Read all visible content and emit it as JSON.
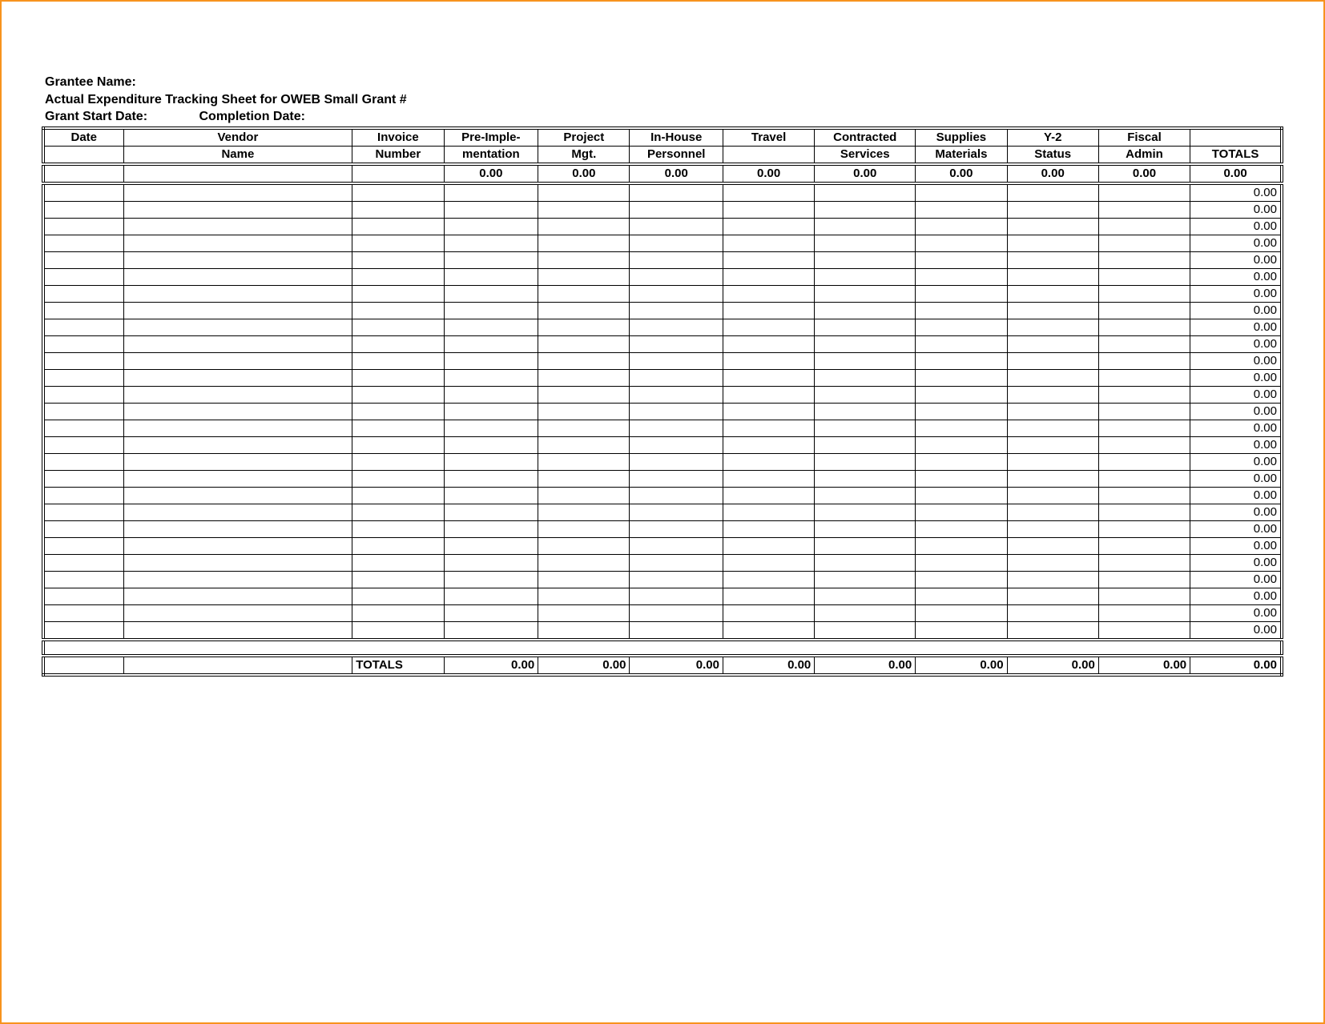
{
  "header": {
    "grantee_label": "Grantee Name:",
    "title": "Actual Expenditure Tracking Sheet for OWEB Small Grant #",
    "start_label": "Grant Start Date:",
    "completion_label": "Completion Date:"
  },
  "columns": {
    "row1": [
      "Date",
      "Vendor",
      "Invoice",
      "Pre-Imple-",
      "Project",
      "In-House",
      "Travel",
      "Contracted",
      "Supplies",
      "Y-2",
      "Fiscal",
      ""
    ],
    "row2": [
      "",
      "Name",
      "Number",
      "mentation",
      "Mgt.",
      "Personnel",
      "",
      "Services",
      "Materials",
      "Status",
      "Admin",
      "TOTALS"
    ]
  },
  "subtotals": [
    "",
    "",
    "",
    "0.00",
    "0.00",
    "0.00",
    "0.00",
    "0.00",
    "0.00",
    "0.00",
    "0.00",
    "0.00"
  ],
  "data_rows_count": 27,
  "row_total_value": "0.00",
  "footer": {
    "label": "TOTALS",
    "values": [
      "0.00",
      "0.00",
      "0.00",
      "0.00",
      "0.00",
      "0.00",
      "0.00",
      "0.00",
      "0.00"
    ]
  }
}
